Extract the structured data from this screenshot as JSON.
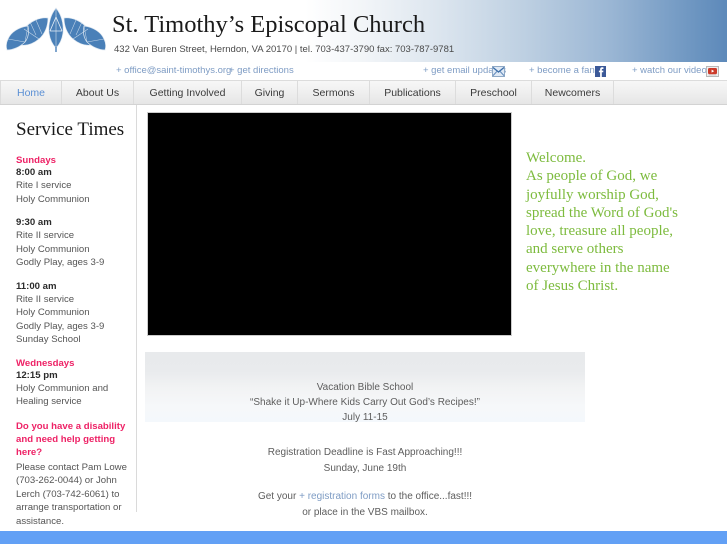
{
  "header": {
    "logo_icon": "church-leaf-logo-icon",
    "title": "St. Timothy’s Episcopal Church",
    "address": "432 Van Buren Street, Herndon, VA 20170  |   tel. 703-437-3790   fax: 703-787-9781",
    "gradient_accent": "#5d89ba"
  },
  "utility_links": [
    {
      "label": "+ office@saint-timothys.org",
      "name": "office-email-link"
    },
    {
      "label": "+ get directions",
      "name": "get-directions-link"
    },
    {
      "label": "+ get email updates",
      "name": "get-email-updates-link",
      "icon": "mail-envelope-icon"
    },
    {
      "label": "+ become a fan",
      "name": "become-a-fan-link",
      "icon": "facebook-icon"
    },
    {
      "label": "+ watch our videos",
      "name": "watch-our-videos-link",
      "icon": "youtube-icon"
    }
  ],
  "nav": {
    "items": [
      {
        "label": "Home",
        "active": true
      },
      {
        "label": "About Us",
        "active": false
      },
      {
        "label": "Getting Involved",
        "active": false
      },
      {
        "label": "Giving",
        "active": false
      },
      {
        "label": "Sermons",
        "active": false
      },
      {
        "label": "Publications",
        "active": false
      },
      {
        "label": "Preschool",
        "active": false
      },
      {
        "label": "Newcomers",
        "active": false
      }
    ],
    "active_color": "#5a8fd4",
    "inactive_color": "#3b3b3b"
  },
  "sidebar": {
    "title": "Service Times",
    "accent_color": "#ee2266",
    "groups": [
      {
        "day": "Sundays",
        "services": [
          {
            "time": "8:00 am",
            "lines": [
              "Rite I service",
              "Holy Communion"
            ]
          },
          {
            "time": "9:30 am",
            "lines": [
              "Rite II service",
              "Holy Communion",
              "Godly Play, ages 3-9"
            ]
          },
          {
            "time": "11:00 am",
            "lines": [
              "Rite II service",
              "Holy Communion",
              "Godly Play, ages 3-9",
              "Sunday School"
            ]
          }
        ]
      },
      {
        "day": "Wednesdays",
        "services": [
          {
            "time": "12:15 pm",
            "lines": [
              "Holy Communion and",
              "Healing service"
            ]
          }
        ]
      }
    ],
    "accessibility": {
      "heading": "Do you have a disability and need help getting here?",
      "body": "Please contact Pam Lowe (703-262-0044) or John Lerch (703-742-6061) to arrange transportation or assistance."
    }
  },
  "main": {
    "video_placeholder_name": "video-player-placeholder",
    "vbs": {
      "line1": "Vacation Bible School",
      "line2": "“Shake it Up-Where Kids Carry Out God’s Recipes!”",
      "line3": "July 11-15"
    },
    "registration": {
      "line1": "Registration Deadline is Fast Approaching!!!",
      "line2": "Sunday, June 19th",
      "line3_before": "Get your ",
      "line3_link": "+ registration forms",
      "line3_after": " to the office...fast!!!",
      "line4": "or place in the VBS mailbox."
    }
  },
  "welcome": {
    "text": "Welcome. As people of God, we joyfully worship God, spread the Word of God's love, treasure all people, and serve others everywhere in the name of Jesus Christ.",
    "color": "#7dbb3e",
    "lines": [
      "Welcome.",
      "As people of God, we",
      "joyfully worship God,",
      "spread the Word of God's",
      "love, treasure all people,",
      "and serve others",
      "everywhere in the name",
      "of Jesus Christ."
    ]
  },
  "footer": {
    "bar_color": "#62a0f5"
  }
}
